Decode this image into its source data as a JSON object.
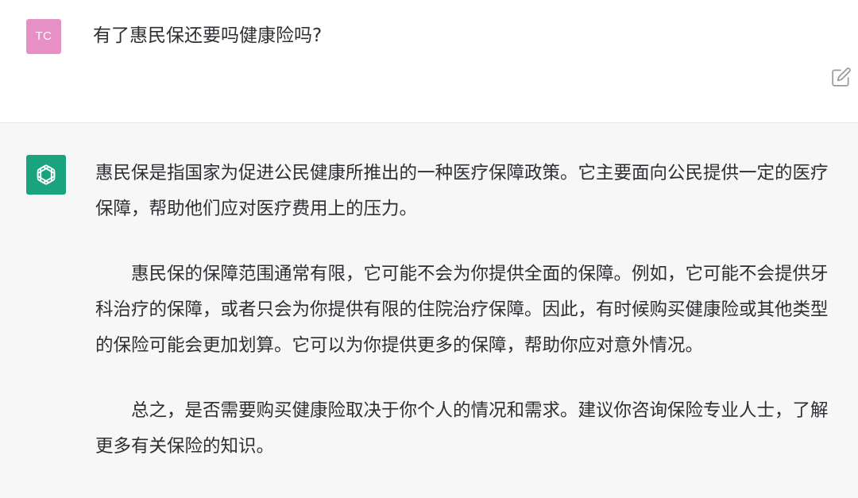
{
  "user_message": {
    "avatar_initials": "TC",
    "text": "有了惠民保还要吗健康险吗?"
  },
  "assistant_message": {
    "paragraphs": [
      "惠民保是指国家为促进公民健康所推出的一种医疗保障政策。它主要面向公民提供一定的医疗保障，帮助他们应对医疗费用上的压力。",
      "惠民保的保障范围通常有限，它可能不会为你提供全面的保障。例如，它可能不会提供牙科治疗的保障，或者只会为你提供有限的住院治疗保障。因此，有时候购买健康险或其他类型的保险可能会更加划算。它可以为你提供更多的保障，帮助你应对意外情况。",
      "总之，是否需要购买健康险取决于你个人的情况和需求。建议你咨询保险专业人士，了解更多有关保险的知识。"
    ]
  },
  "icons": {
    "edit": "edit-icon",
    "assistant_logo": "openai-logo-icon"
  },
  "colors": {
    "user_avatar_bg": "#e790c6",
    "assistant_avatar_bg": "#19a37f",
    "assistant_bg": "#f7f7f8",
    "text": "#2f2f33"
  }
}
